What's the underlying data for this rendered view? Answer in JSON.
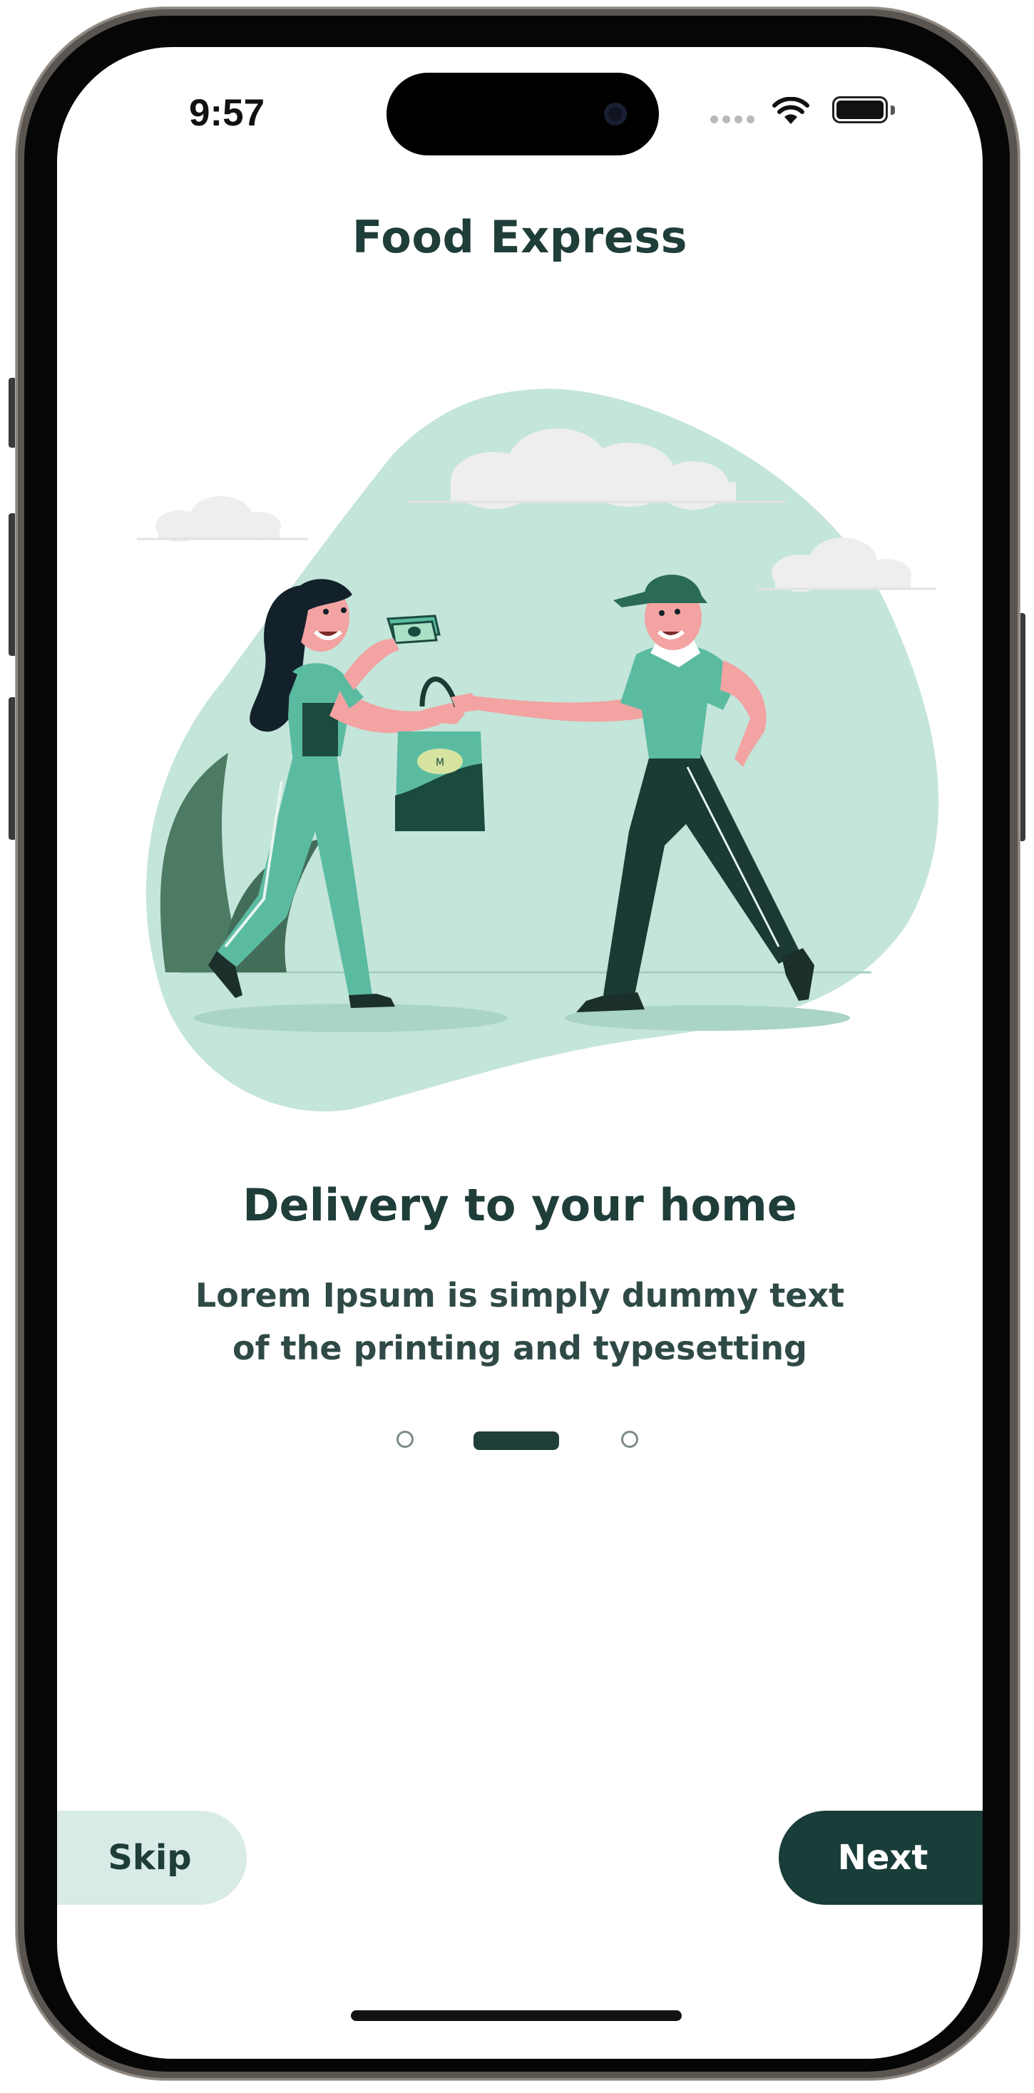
{
  "status_bar": {
    "time": "9:57",
    "icons": [
      "cellular-signal-icon",
      "wifi-icon",
      "battery-icon"
    ]
  },
  "app": {
    "title": "Food Express"
  },
  "illustration": {
    "name": "delivery-illustration",
    "colors": {
      "blob": "#c4e5da",
      "green": "#5bbba1",
      "dark_green": "#1b4a3f",
      "skin": "#f2a3a2",
      "hair": "#13212b",
      "cloud": "#eeeeee"
    }
  },
  "onboarding": {
    "heading": "Delivery to your home",
    "description_line1": "Lorem Ipsum is simply dummy text",
    "description_line2": "of the printing and typesetting",
    "page_indicator": {
      "current": 2,
      "total": 3
    }
  },
  "actions": {
    "skip_label": "Skip",
    "next_label": "Next"
  },
  "colors": {
    "primary": "#1f3d39",
    "skip_bg": "#d9ebe6",
    "next_bg": "#193d38"
  }
}
